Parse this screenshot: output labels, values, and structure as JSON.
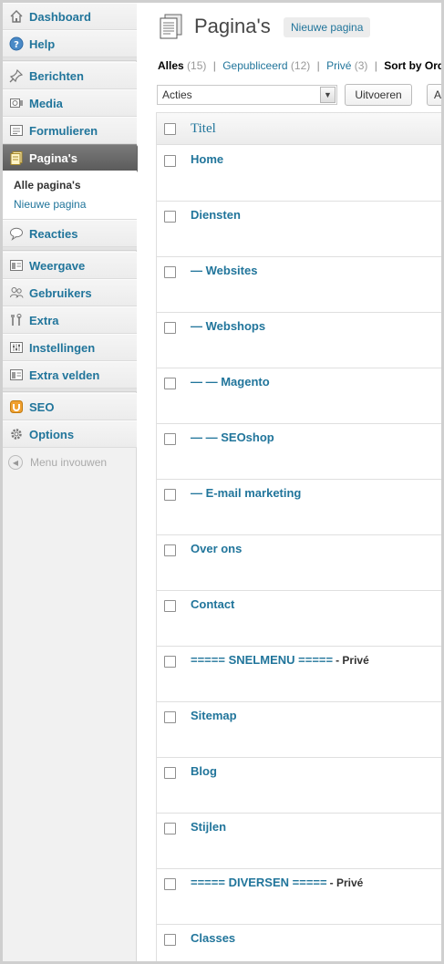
{
  "sidebar": {
    "items": [
      {
        "id": "dashboard",
        "label": "Dashboard",
        "icon": "home-icon"
      },
      {
        "id": "help",
        "label": "Help",
        "icon": "help-icon"
      },
      {
        "id": "berichten",
        "label": "Berichten",
        "icon": "pushpin-icon"
      },
      {
        "id": "media",
        "label": "Media",
        "icon": "media-icon"
      },
      {
        "id": "formulieren",
        "label": "Formulieren",
        "icon": "form-icon"
      },
      {
        "id": "paginas",
        "label": "Pagina's",
        "icon": "pages-icon",
        "active": true
      },
      {
        "id": "reacties",
        "label": "Reacties",
        "icon": "comment-icon"
      },
      {
        "id": "weergave",
        "label": "Weergave",
        "icon": "appearance-icon"
      },
      {
        "id": "gebruikers",
        "label": "Gebruikers",
        "icon": "users-icon"
      },
      {
        "id": "extra",
        "label": "Extra",
        "icon": "tools-icon"
      },
      {
        "id": "instellingen",
        "label": "Instellingen",
        "icon": "settings-icon"
      },
      {
        "id": "extra-velden",
        "label": "Extra velden",
        "icon": "fields-icon"
      },
      {
        "id": "seo",
        "label": "SEO",
        "icon": "seo-icon"
      },
      {
        "id": "options",
        "label": "Options",
        "icon": "gear-icon"
      }
    ],
    "submenu": [
      "Alle pagina's",
      "Nieuwe pagina"
    ],
    "collapse_label": "Menu invouwen"
  },
  "header": {
    "title": "Pagina's",
    "add_new": "Nieuwe pagina"
  },
  "filters": {
    "all": {
      "label": "Alles",
      "count": "(15)"
    },
    "published": {
      "label": "Gepubliceerd",
      "count": "(12)"
    },
    "private": {
      "label": "Privé",
      "count": "(3)"
    },
    "sort": "Sort by Order"
  },
  "bulk": {
    "selected": "Acties",
    "apply": "Uitvoeren",
    "next_partial": "Al"
  },
  "table": {
    "column_title": "Titel",
    "rows": [
      {
        "title": "Home",
        "state": ""
      },
      {
        "title": "Diensten",
        "state": ""
      },
      {
        "title": "— Websites",
        "state": ""
      },
      {
        "title": "— Webshops",
        "state": ""
      },
      {
        "title": "— — Magento",
        "state": ""
      },
      {
        "title": "— — SEOshop",
        "state": ""
      },
      {
        "title": "— E-mail marketing",
        "state": ""
      },
      {
        "title": "Over ons",
        "state": ""
      },
      {
        "title": "Contact",
        "state": ""
      },
      {
        "title": "===== SNELMENU =====",
        "state": "- Privé"
      },
      {
        "title": "Sitemap",
        "state": ""
      },
      {
        "title": "Blog",
        "state": ""
      },
      {
        "title": "Stijlen",
        "state": ""
      },
      {
        "title": "===== DIVERSEN =====",
        "state": "- Privé"
      },
      {
        "title": "Classes",
        "state": ""
      }
    ]
  },
  "colors": {
    "link": "#21759b",
    "active_menu": "#6a6a6a",
    "seo_orange": "#f0a030"
  }
}
